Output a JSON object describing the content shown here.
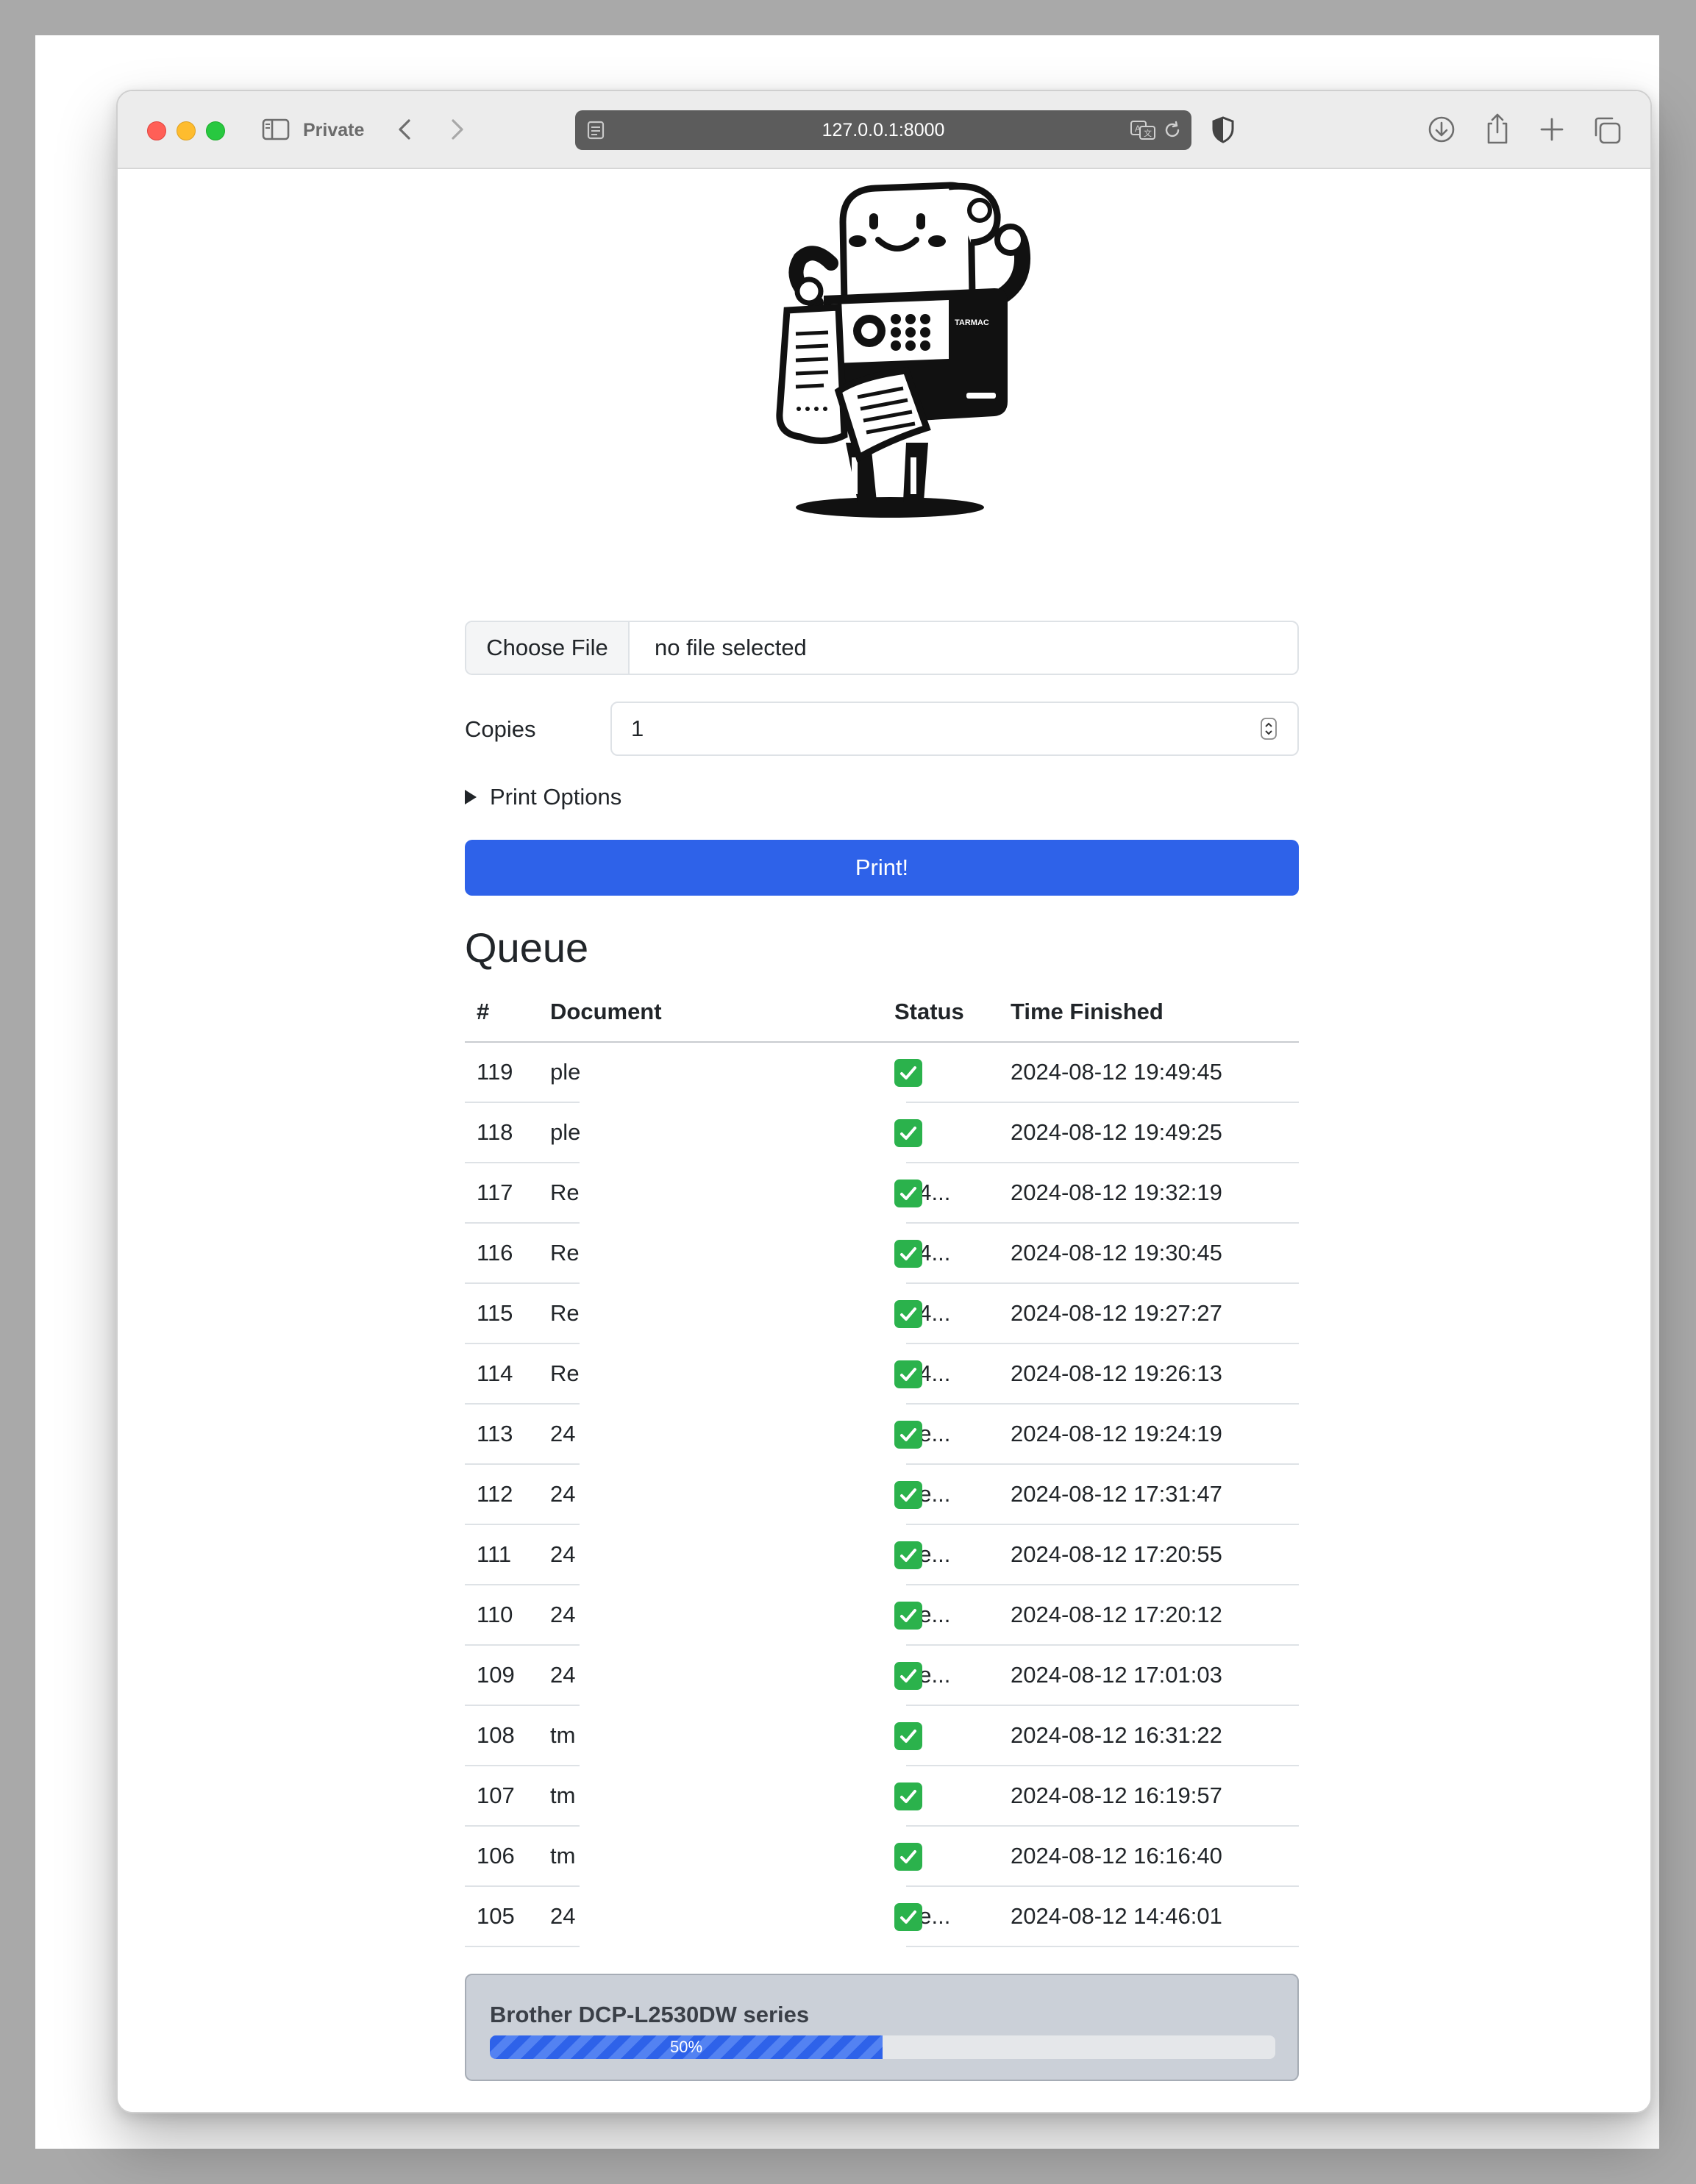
{
  "browser": {
    "mode_label": "Private",
    "url": "127.0.0.1:8000"
  },
  "upload": {
    "button_label": "Choose File",
    "status": "no file selected"
  },
  "copies": {
    "label": "Copies",
    "value": "1"
  },
  "print_options_label": "Print Options",
  "print_button_label": "Print!",
  "queue": {
    "title": "Queue",
    "columns": [
      "#",
      "Document",
      "Status",
      "Time Finished"
    ],
    "rows": [
      {
        "num": "119",
        "doc": "ple",
        "tail": "",
        "time": "2024-08-12 19:49:45"
      },
      {
        "num": "118",
        "doc": "ple",
        "tail": "",
        "time": "2024-08-12 19:49:25"
      },
      {
        "num": "117",
        "doc": "Re",
        "tail": "24...",
        "time": "2024-08-12 19:32:19"
      },
      {
        "num": "116",
        "doc": "Re",
        "tail": "24...",
        "time": "2024-08-12 19:30:45"
      },
      {
        "num": "115",
        "doc": "Re",
        "tail": "24...",
        "time": "2024-08-12 19:27:27"
      },
      {
        "num": "114",
        "doc": "Re",
        "tail": "24...",
        "time": "2024-08-12 19:26:13"
      },
      {
        "num": "113",
        "doc": "24",
        "tail": "ne...",
        "time": "2024-08-12 19:24:19"
      },
      {
        "num": "112",
        "doc": "24",
        "tail": "ne...",
        "time": "2024-08-12 17:31:47"
      },
      {
        "num": "111",
        "doc": "24",
        "tail": "ne...",
        "time": "2024-08-12 17:20:55"
      },
      {
        "num": "110",
        "doc": "24",
        "tail": "ne...",
        "time": "2024-08-12 17:20:12"
      },
      {
        "num": "109",
        "doc": "24",
        "tail": "ne...",
        "time": "2024-08-12 17:01:03"
      },
      {
        "num": "108",
        "doc": "tm",
        "tail": "",
        "time": "2024-08-12 16:31:22"
      },
      {
        "num": "107",
        "doc": "tm",
        "tail": "",
        "time": "2024-08-12 16:19:57"
      },
      {
        "num": "106",
        "doc": "tm",
        "tail": "",
        "time": "2024-08-12 16:16:40"
      },
      {
        "num": "105",
        "doc": "24",
        "tail": "ne...",
        "time": "2024-08-12 14:46:01"
      }
    ],
    "status_icon": "check-mark-icon"
  },
  "printer": {
    "name": "Brother DCP-L2530DW series",
    "progress_percent": 50,
    "progress_label": "50%"
  },
  "colors": {
    "primary": "#2e62e9",
    "success": "#2bb24c"
  }
}
